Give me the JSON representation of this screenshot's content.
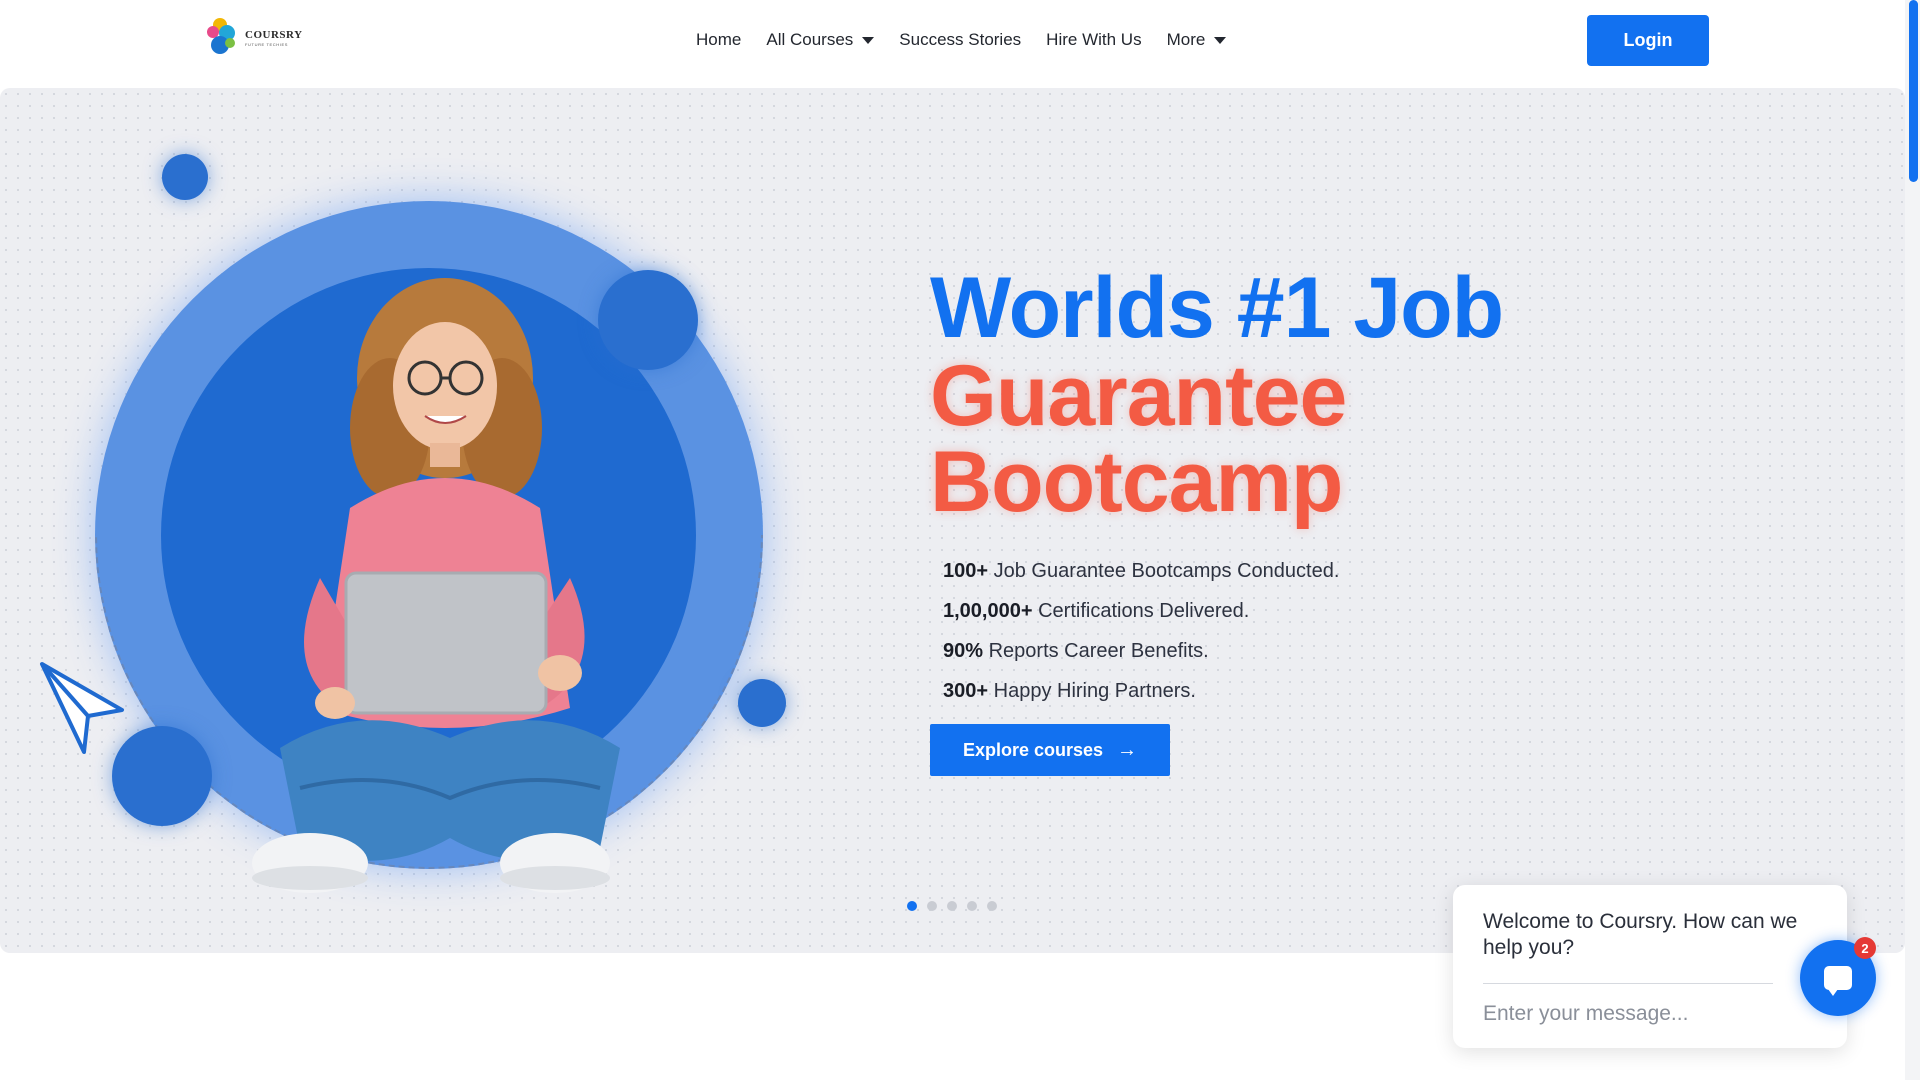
{
  "brand": {
    "name": "COURSRY",
    "tagline": "FUTURE TECHIES"
  },
  "nav": {
    "items": [
      {
        "label": "Home",
        "has_caret": false
      },
      {
        "label": "All Courses",
        "has_caret": true
      },
      {
        "label": "Success Stories",
        "has_caret": false
      },
      {
        "label": "Hire With Us",
        "has_caret": false
      },
      {
        "label": "More",
        "has_caret": true
      }
    ],
    "login_label": "Login"
  },
  "hero": {
    "headline_blue": "Worlds #1 Job",
    "headline_orange_1": "Guarantee",
    "headline_orange_2": "Bootcamp",
    "stats": [
      {
        "value": "100+",
        "text": "Job Guarantee Bootcamps Conducted."
      },
      {
        "value": "1,00,000+",
        "text": "Certifications Delivered."
      },
      {
        "value": "90%",
        "text": "Reports Career Benefits."
      },
      {
        "value": "300+",
        "text": "Happy Hiring Partners."
      }
    ],
    "cta_label": "Explore courses",
    "carousel": {
      "total": 5,
      "active": 1
    }
  },
  "chat": {
    "welcome": "Welcome to Coursry. How can we help you?",
    "input_placeholder": "Enter your message...",
    "badge_count": "2"
  },
  "colors": {
    "accent_blue": "#1271f0",
    "headline_orange": "#f35b44",
    "hero_bg": "#edeef2"
  },
  "icons": {
    "caret": "caret-down-icon",
    "cta_arrow": "arrow-right-icon",
    "chat": "chat-bubble-icon",
    "paper_plane": "paper-plane-icon"
  }
}
